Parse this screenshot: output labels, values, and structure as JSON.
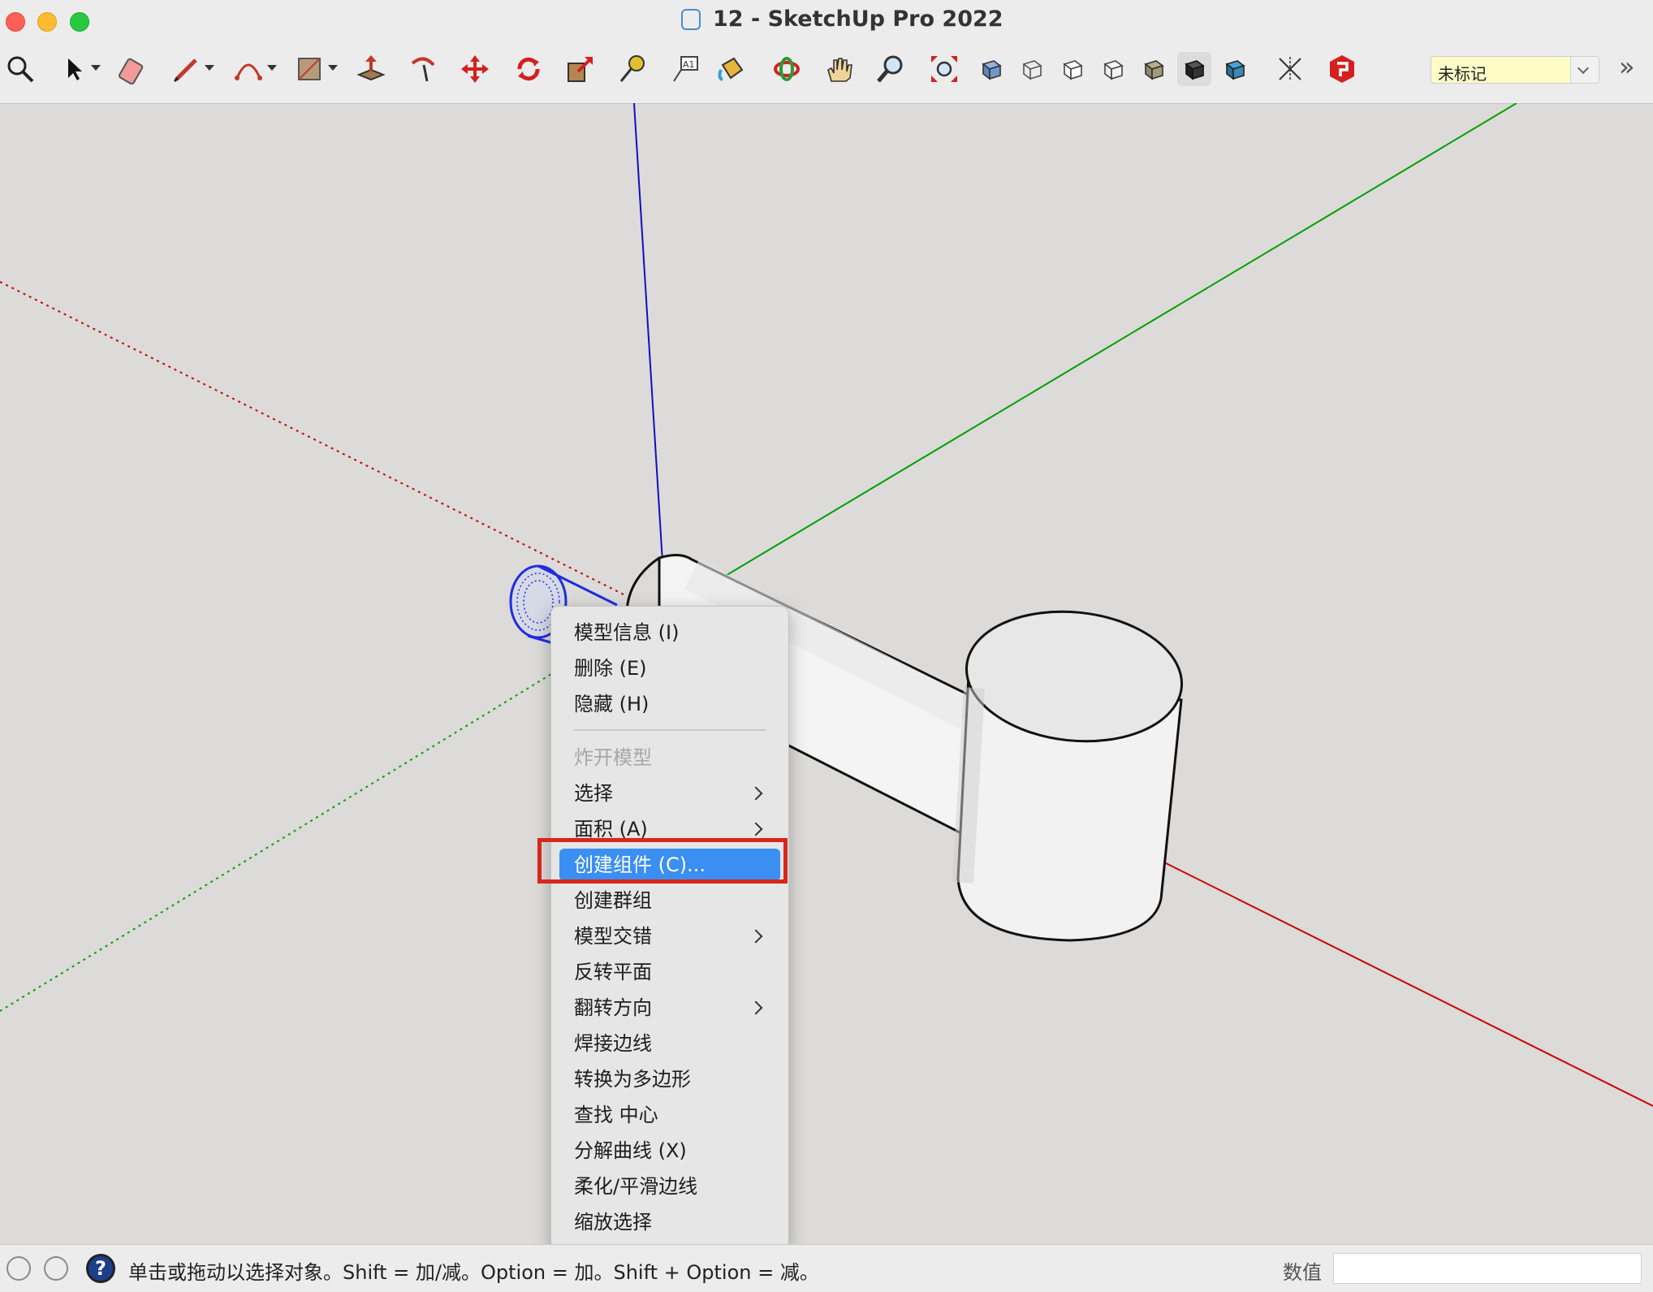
{
  "window": {
    "title": "12 - SketchUp Pro 2022"
  },
  "toolbar": {
    "tools": [
      "search-icon",
      "select-arrow-icon",
      "eraser-icon",
      "pencil-line-icon",
      "arc-icon",
      "rectangle-icon",
      "push-pull-icon",
      "follow-me-icon",
      "move-icon",
      "rotate-icon",
      "scale-icon",
      "tape-measure-icon",
      "text-label-icon",
      "paint-bucket-icon",
      "orbit-icon",
      "pan-hand-icon",
      "zoom-icon",
      "zoom-extents-icon",
      "xray-style-icon",
      "wireframe-style-icon",
      "hidden-line-style-icon",
      "shaded-style-icon",
      "shaded-textures-icon",
      "monochrome-style-icon",
      "section-plane-icon",
      "axes-icon",
      "extension-warehouse-icon"
    ],
    "tag_select": "未标记"
  },
  "context_menu": {
    "items": [
      {
        "label": "模型信息 (I)",
        "disabled": false,
        "submenu": false
      },
      {
        "label": "删除 (E)",
        "disabled": false,
        "submenu": false
      },
      {
        "label": "隐藏 (H)",
        "disabled": false,
        "submenu": false
      },
      {
        "label": "炸开模型",
        "disabled": true,
        "submenu": false
      },
      {
        "label": "选择",
        "disabled": false,
        "submenu": true
      },
      {
        "label": "面积 (A)",
        "disabled": false,
        "submenu": true
      },
      {
        "label": "创建组件 (C)...",
        "disabled": false,
        "submenu": false,
        "highlighted": true
      },
      {
        "label": "创建群组",
        "disabled": false,
        "submenu": false
      },
      {
        "label": "模型交错",
        "disabled": false,
        "submenu": true
      },
      {
        "label": "反转平面",
        "disabled": false,
        "submenu": false
      },
      {
        "label": "翻转方向",
        "disabled": false,
        "submenu": true
      },
      {
        "label": "焊接边线",
        "disabled": false,
        "submenu": false
      },
      {
        "label": "转换为多边形",
        "disabled": false,
        "submenu": false
      },
      {
        "label": "查找 中心",
        "disabled": false,
        "submenu": false
      },
      {
        "label": "分解曲线 (X)",
        "disabled": false,
        "submenu": false
      },
      {
        "label": "柔化/平滑边线",
        "disabled": false,
        "submenu": false
      },
      {
        "label": "缩放选择",
        "disabled": false,
        "submenu": false
      }
    ]
  },
  "statusbar": {
    "hint": "单击或拖动以选择对象。Shift = 加/减。Option = 加。Shift + Option = 减。",
    "measure_label": "数值",
    "measure_value": ""
  },
  "colors": {
    "axis_red": "#cc0000",
    "axis_green": "#00a000",
    "axis_blue": "#1010c0",
    "highlight": "#3b8ef2",
    "annotation_box": "#d9261c"
  }
}
